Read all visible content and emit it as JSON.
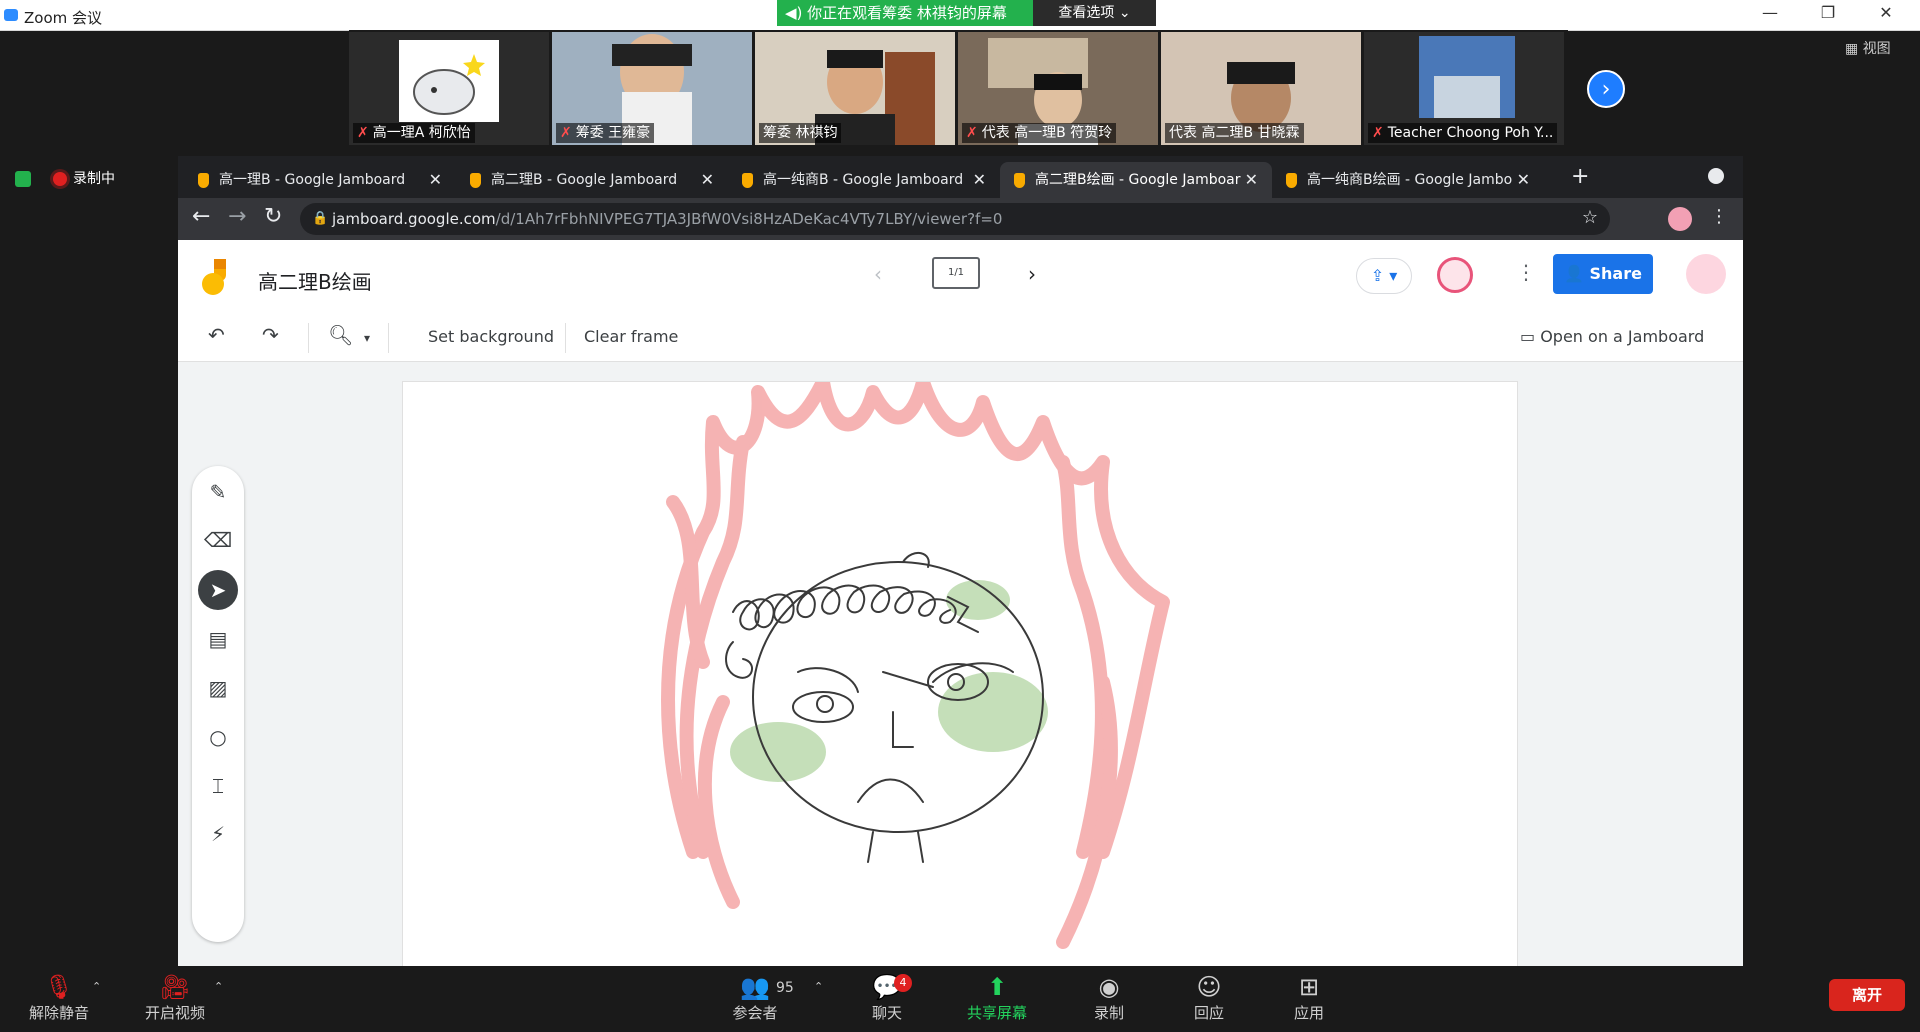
{
  "zoom": {
    "window_title": "Zoom 会议",
    "viewing_banner": "你正在观看筹委 林祺钧的屏幕",
    "view_options": "查看选项 ⌄",
    "view_button": "视图",
    "recording_label": "录制中",
    "participants": [
      {
        "name": "高一理A 柯欣怡",
        "muted": true
      },
      {
        "name": "筹委 王雍豪",
        "muted": true
      },
      {
        "name": "筹委 林祺钧",
        "muted": false
      },
      {
        "name": "代表 高一理B 符贺玲",
        "muted": true
      },
      {
        "name": "代表 高二理B 甘晓霖",
        "muted": false
      },
      {
        "name": "Teacher Choong Poh Y...",
        "muted": true
      }
    ],
    "bottom_bar": {
      "mute_label": "解除静音",
      "video_label": "开启视频",
      "participants_label": "参会者",
      "participants_count": "95",
      "chat_label": "聊天",
      "chat_badge": "4",
      "share_label": "共享屏幕",
      "record_label": "录制",
      "reactions_label": "回应",
      "apps_label": "应用",
      "leave_label": "离开"
    }
  },
  "browser": {
    "tabs": [
      {
        "title": "高一理B - Google Jamboard",
        "active": false
      },
      {
        "title": "高二理B - Google Jamboard",
        "active": false
      },
      {
        "title": "高一纯商B - Google Jamboard",
        "active": false
      },
      {
        "title": "高二理B绘画 - Google Jamboar",
        "active": true
      },
      {
        "title": "高一纯商B绘画 - Google Jambo",
        "active": false
      }
    ],
    "url_host": "jamboard.google.com",
    "url_path": "/d/1Ah7rFbhNIVPEG7TJA3JBfW0Vsi8HzADeKac4VTy7LBY/viewer?f=0"
  },
  "jamboard": {
    "title": "高二理B绘画",
    "frame_indicator": "1/1",
    "share_label": "Share",
    "toolbar": {
      "set_background": "Set background",
      "clear_frame": "Clear frame",
      "open_on_jamboard": "Open on a Jamboard"
    },
    "tools": [
      "pen-icon",
      "eraser-icon",
      "select-icon",
      "sticky-note-icon",
      "image-icon",
      "circle-icon",
      "text-box-icon",
      "laser-icon"
    ],
    "selected_tool": "select-icon"
  },
  "colors": {
    "zoom_green": "#23b14d",
    "jamboard_blue": "#1a73e8",
    "leave_red": "#d9251d",
    "flame_pink": "#f4a6a6",
    "cheek_green": "#b7d7a8"
  }
}
